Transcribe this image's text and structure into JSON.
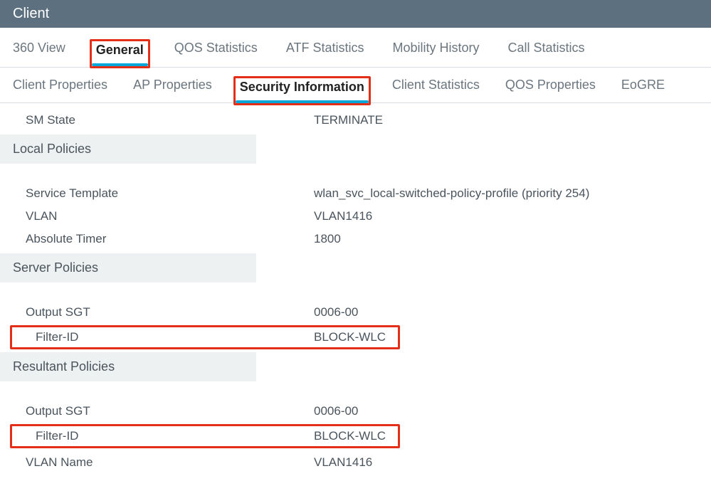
{
  "header": {
    "title": "Client"
  },
  "tabs_primary": [
    {
      "label": "360 View",
      "active": false
    },
    {
      "label": "General",
      "active": true
    },
    {
      "label": "QOS Statistics",
      "active": false
    },
    {
      "label": "ATF Statistics",
      "active": false
    },
    {
      "label": "Mobility History",
      "active": false
    },
    {
      "label": "Call Statistics",
      "active": false
    }
  ],
  "tabs_secondary": [
    {
      "label": "Client Properties",
      "active": false
    },
    {
      "label": "AP Properties",
      "active": false
    },
    {
      "label": "Security Information",
      "active": true
    },
    {
      "label": "Client Statistics",
      "active": false
    },
    {
      "label": "QOS Properties",
      "active": false
    },
    {
      "label": "EoGRE",
      "active": false
    }
  ],
  "rows": {
    "sm_state": {
      "label": "SM State",
      "value": "TERMINATE"
    }
  },
  "sections": {
    "local_policies": {
      "header": "Local Policies",
      "rows": [
        {
          "label": "Service Template",
          "value": "wlan_svc_local-switched-policy-profile (priority 254)"
        },
        {
          "label": "VLAN",
          "value": "VLAN1416"
        },
        {
          "label": "Absolute Timer",
          "value": "1800"
        }
      ]
    },
    "server_policies": {
      "header": "Server Policies",
      "rows": [
        {
          "label": "Output SGT",
          "value": "0006-00"
        },
        {
          "label": "Filter-ID",
          "value": "BLOCK-WLC",
          "highlight": true
        }
      ]
    },
    "resultant_policies": {
      "header": "Resultant Policies",
      "rows": [
        {
          "label": "Output SGT",
          "value": "0006-00"
        },
        {
          "label": "Filter-ID",
          "value": "BLOCK-WLC",
          "highlight": true
        },
        {
          "label": "VLAN Name",
          "value": "VLAN1416"
        }
      ]
    }
  },
  "highlight_color": "#e52e18"
}
